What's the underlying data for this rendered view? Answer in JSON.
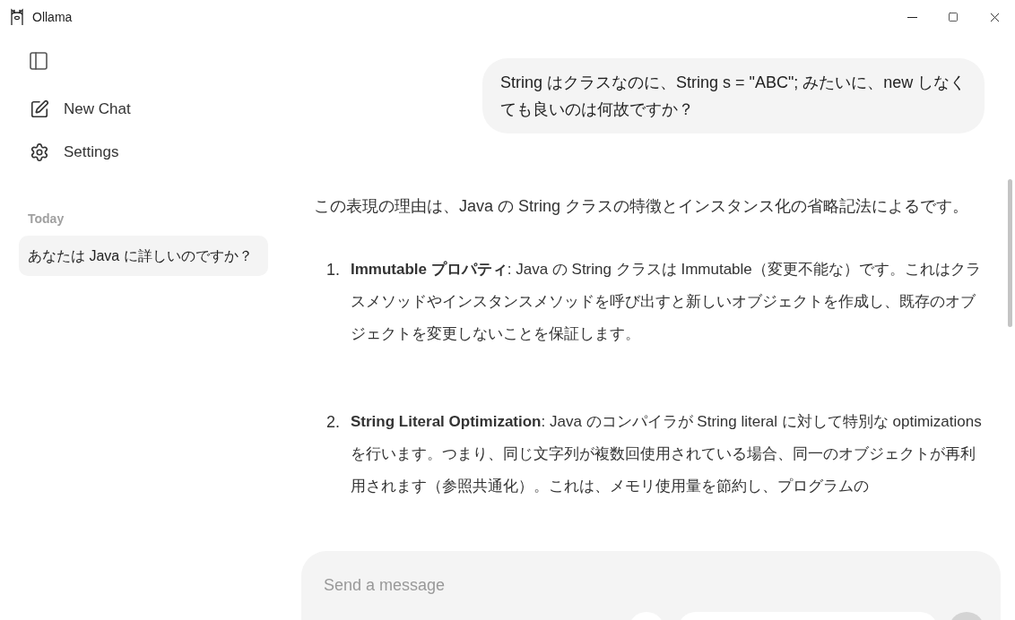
{
  "window": {
    "title": "Ollama"
  },
  "sidebar": {
    "actions": [
      {
        "kind": "new-chat",
        "label": "New Chat"
      },
      {
        "kind": "settings",
        "label": "Settings"
      }
    ],
    "history_groups": [
      {
        "heading": "Today",
        "items": [
          {
            "title": "あなたは Java に詳しいのですか？",
            "selected": true
          }
        ]
      }
    ]
  },
  "chat": {
    "user_message": "String はクラスなのに、String s = \"ABC\"; みたいに、new しなくても良いのは何故ですか？",
    "reply_intro": "この表現の理由は、Java の String クラスの特徴とインスタンス化の省略記法によるです。",
    "reply_items": [
      {
        "number": "1.",
        "text": "**Immutable プロパティ**: Java の String クラスは Immutable（変更不能な）です。これはクラスメソッドやインスタンスメソッドを呼び出すと新しいオブジェクトを作成し、既存のオブジェクトを変更しないことを保証します。"
      },
      {
        "number": "2.",
        "text": "**String Literal Optimization**: Java のコンパイラが String literal に対して特別な optimizations を行います。つまり、同じ文字列が複数回使用されている場合、同一のオブジェクトが再利用されます（参照共通化）。これは、メモリ使用量を節約し、プログラムの"
      }
    ]
  },
  "composer": {
    "placeholder": "Send a message"
  }
}
